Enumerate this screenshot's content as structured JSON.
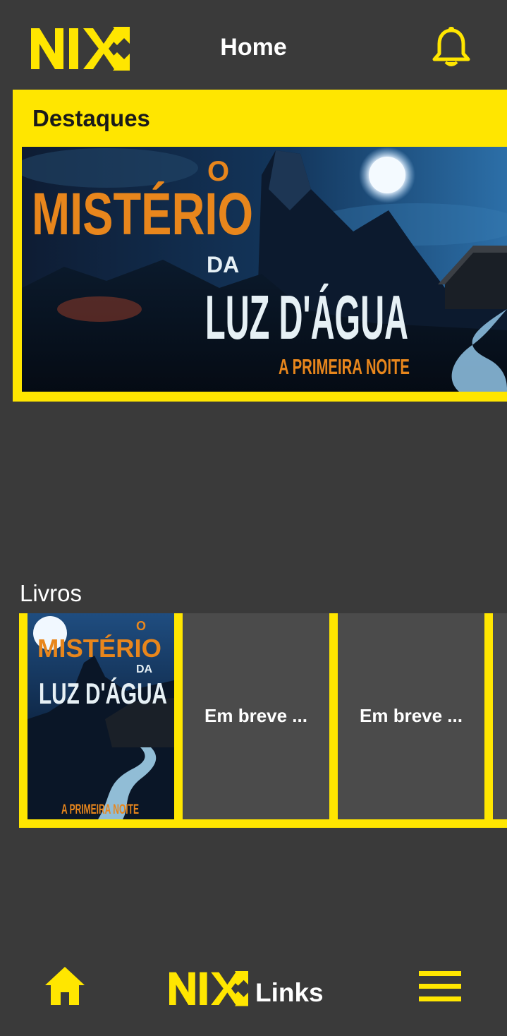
{
  "header": {
    "logo_text": "NIX",
    "title": "Home",
    "notification_icon": "bell-icon"
  },
  "featured": {
    "title": "Destaques",
    "banner": {
      "line1": "O",
      "line2": "MISTÉRIO",
      "line3": "DA",
      "line4": "LUZ D'ÁGUA",
      "subtitle": "A PRIMEIRA NOITE"
    }
  },
  "books": {
    "title": "Livros",
    "items": [
      {
        "type": "cover",
        "line1": "O",
        "line2": "MISTÉRIO",
        "line3": "DA",
        "line4": "LUZ D'ÁGUA",
        "subtitle": "A PRIMEIRA NOITE"
      },
      {
        "type": "placeholder",
        "label": "Em breve ..."
      },
      {
        "type": "placeholder",
        "label": "Em breve ..."
      }
    ]
  },
  "bottom_nav": {
    "home_icon": "home-icon",
    "links_logo": "NIX",
    "links_label": "Links",
    "menu_icon": "hamburger-menu-icon"
  },
  "colors": {
    "background": "#3a3a3a",
    "accent": "#ffe600",
    "tile": "#4b4b4b",
    "title_orange": "#e8861c",
    "title_white": "#e6f0f5"
  }
}
